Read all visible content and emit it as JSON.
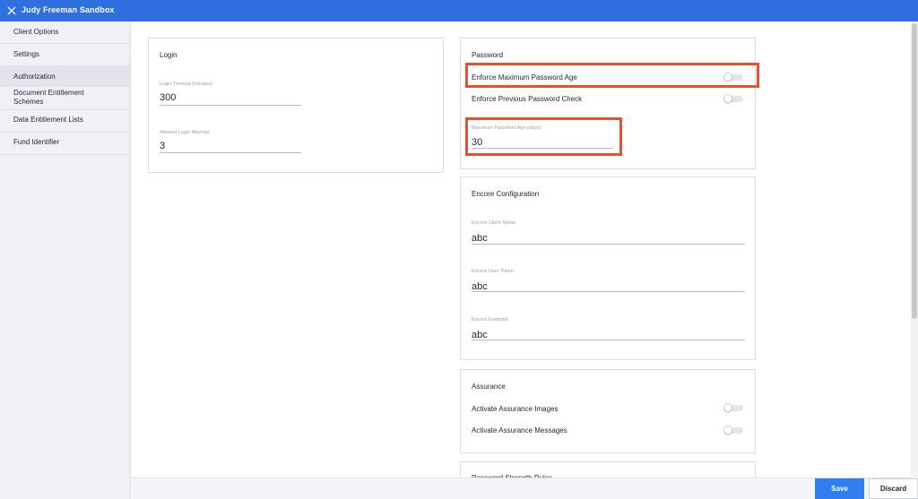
{
  "window": {
    "title": "Judy Freeman Sandbox",
    "close_icon": "close-icon"
  },
  "sidebar": {
    "items": [
      {
        "label": "Client Options"
      },
      {
        "label": "Settings"
      },
      {
        "label": "Authorization",
        "active": true
      },
      {
        "label": "Document Entitlement",
        "label2": "Schemes"
      },
      {
        "label": "Data Entitlement Lists"
      },
      {
        "label": "Fund Identifier"
      }
    ]
  },
  "login": {
    "title": "Login",
    "timeout_label": "Login Timeout (minutes)",
    "timeout_value": "300",
    "attempts_label": "Allowed Login Attemps",
    "attempts_value": "3"
  },
  "password": {
    "title": "Password",
    "enforce_max_age_label": "Enforce Maximum Password Age",
    "enforce_prev_check_label": "Enforce Previous Password Check",
    "max_age_label": "Maximum Password Age (days)",
    "max_age_value": "30"
  },
  "encore": {
    "title": "Encore Configuration",
    "client_name_label": "Encore Client Name",
    "client_name_value": "abc",
    "user_token_label": "Encore User Token",
    "user_token_value": "abc",
    "endpoint_label": "Encore Endpoint",
    "endpoint_value": "abc"
  },
  "assurance": {
    "title": "Assurance",
    "images_label": "Activate Assurance Images",
    "messages_label": "Activate Assurance Messages"
  },
  "password_strength": {
    "title": "Password Strength Rules"
  },
  "footer": {
    "save_label": "Save",
    "discard_label": "Discard"
  },
  "colors": {
    "accent": "#2f6fdf",
    "save": "#2f7ff0",
    "highlight": "#e8502f"
  }
}
